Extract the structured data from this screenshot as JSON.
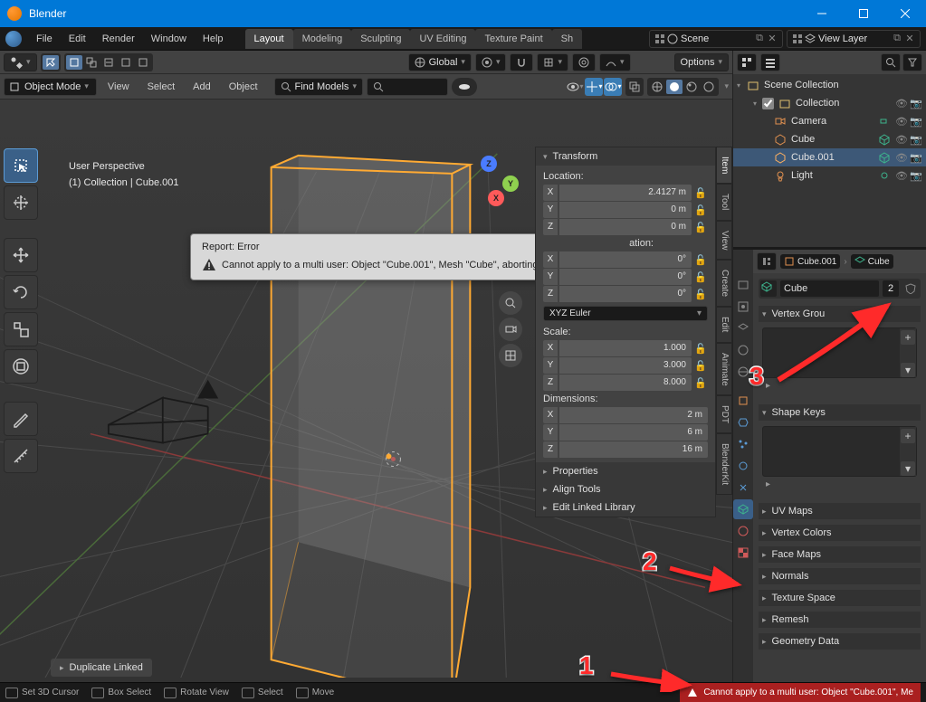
{
  "titlebar": {
    "title": "Blender"
  },
  "menus": {
    "file": "File",
    "edit": "Edit",
    "render": "Render",
    "window": "Window",
    "help": "Help"
  },
  "workspace_tabs": [
    "Layout",
    "Modeling",
    "Sculpting",
    "UV Editing",
    "Texture Paint",
    "Sh"
  ],
  "workspace_active": "Layout",
  "scene": {
    "name": "Scene",
    "viewlayer": "View Layer"
  },
  "header": {
    "orientation": "Global",
    "options": "Options",
    "mode": "Object Mode",
    "menus": [
      "View",
      "Select",
      "Add",
      "Object"
    ],
    "find": "Find Models"
  },
  "overlay": {
    "line1": "User Perspective",
    "line2": "(1) Collection | Cube.001"
  },
  "report": {
    "title": "Report: Error",
    "body": "Cannot apply to a multi user: Object \"Cube.001\", Mesh \"Cube\", aborting"
  },
  "last_op": "Duplicate Linked",
  "statusbar": {
    "items": [
      "Set 3D Cursor",
      "Box Select",
      "Rotate View",
      "Select",
      "Move"
    ],
    "error": "Cannot apply to a multi user: Object \"Cube.001\", Me"
  },
  "npanel": {
    "transform": "Transform",
    "location": "Location:",
    "rotation_label": "ation:",
    "scale": "Scale:",
    "dimensions": "Dimensions:",
    "loc": {
      "x": "2.4127 m",
      "y": "0 m",
      "z": "0 m"
    },
    "rot": {
      "x": "0°",
      "y": "0°",
      "z": "0°"
    },
    "euler": "XYZ Euler",
    "scl": {
      "x": "1.000",
      "y": "3.000",
      "z": "8.000"
    },
    "dim": {
      "x": "2 m",
      "y": "6 m",
      "z": "16 m"
    },
    "properties": "Properties",
    "align": "Align Tools",
    "linked": "Edit Linked Library"
  },
  "ntabs": [
    "Item",
    "Tool",
    "View",
    "Create",
    "Edit",
    "Animate",
    "PDT",
    "BlenderKit"
  ],
  "outliner": {
    "scene_collection": "Scene Collection",
    "collection": "Collection",
    "camera": "Camera",
    "cube": "Cube",
    "cube001": "Cube.001",
    "light": "Light"
  },
  "props": {
    "breadcrumb_obj": "Cube.001",
    "breadcrumb_mesh": "Cube",
    "mesh": "Cube",
    "users": "2",
    "vertex_groups": "Vertex Grou",
    "shape_keys": "Shape Keys",
    "uv_maps": "UV Maps",
    "vertex_colors": "Vertex Colors",
    "face_maps": "Face Maps",
    "normals": "Normals",
    "texture_space": "Texture Space",
    "remesh": "Remesh",
    "geometry_data": "Geometry Data"
  },
  "annotations": {
    "n1": "1",
    "n2": "2",
    "n3": "3"
  }
}
